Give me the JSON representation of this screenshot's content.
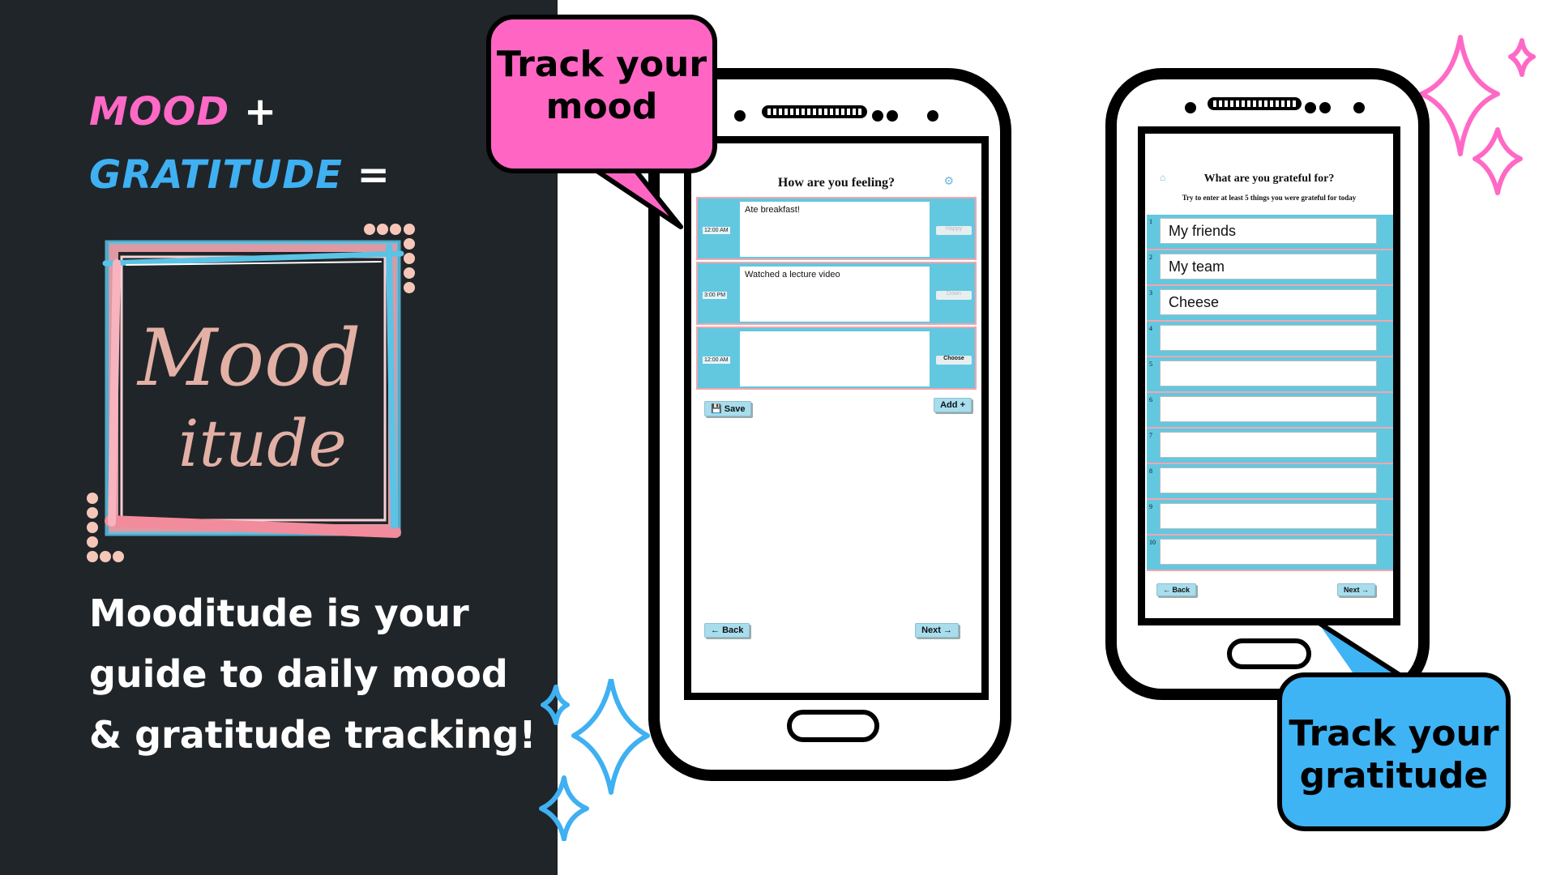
{
  "left_panel": {
    "headline_mood": "MOOD",
    "headline_plus": "+",
    "headline_gratitude": "GRATITUDE",
    "headline_equals": "=",
    "logo_script_line1": "Mood",
    "logo_script_line2": "itude",
    "tagline": [
      "Mooditude is your",
      "guide to daily mood",
      "& gratitude tracking!"
    ]
  },
  "bubbles": {
    "mood": [
      "Track your",
      "mood"
    ],
    "gratitude": [
      "Track your",
      "gratitude"
    ]
  },
  "mood_screen": {
    "title": "How are you feeling?",
    "icon": "gear-icon",
    "rows": [
      {
        "time": "12:00 AM",
        "entry": "Ate breakfast!",
        "mood": "Happy"
      },
      {
        "time": "3:00 PM",
        "entry": "Watched a lecture video",
        "mood": "Down"
      },
      {
        "time": "12:00 AM",
        "entry": "",
        "mood": "Choose"
      }
    ],
    "save_label": "Save",
    "add_label": "Add",
    "back_label": "Back",
    "next_label": "Next"
  },
  "gratitude_screen": {
    "title": "What are you grateful for?",
    "subtitle": "Try to enter at least 5 things you were grateful for today",
    "icon": "home-icon",
    "items": [
      {
        "num": "1",
        "value": "My friends"
      },
      {
        "num": "2",
        "value": "My team"
      },
      {
        "num": "3",
        "value": "Cheese"
      },
      {
        "num": "4",
        "value": ""
      },
      {
        "num": "5",
        "value": ""
      },
      {
        "num": "6",
        "value": ""
      },
      {
        "num": "7",
        "value": ""
      },
      {
        "num": "8",
        "value": ""
      },
      {
        "num": "9",
        "value": ""
      },
      {
        "num": "10",
        "value": ""
      }
    ],
    "back_label": "Back",
    "next_label": "Next"
  },
  "colors": {
    "dark_panel": "#202529",
    "pink": "#ff69c6",
    "blue": "#3fb0f2",
    "row_blue": "#62c8e0",
    "row_border_pink": "#f2a6ad"
  }
}
